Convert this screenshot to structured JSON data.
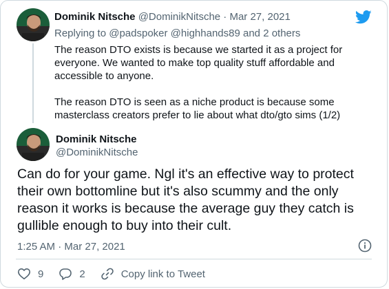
{
  "reply": {
    "author_name": "Dominik Nitsche",
    "author_handle": "@DominikNitsche",
    "separator": "·",
    "date": "Mar 27, 2021",
    "replying_prefix": "Replying to",
    "replying_to": [
      "@padspoker",
      "@highhands89"
    ],
    "replying_and": "and",
    "replying_others": "2 others",
    "paragraphs": [
      "The reason DTO exists is because we started it as a project for everyone. We wanted to make top quality stuff affordable and accessible to anyone.",
      "The reason DTO is seen as a niche product is because some masterclass creators prefer to lie about what dto/gto sims (1/2)"
    ]
  },
  "main_tweet": {
    "author_name": "Dominik Nitsche",
    "author_handle": "@DominikNitsche",
    "text": "Can do for your game. Ngl it's an effective way to protect their own bottomline but it's also scummy and the only reason it works is because the average guy they catch is gullible  enough to buy into their cult.",
    "time": "1:25 AM",
    "separator": "·",
    "date": "Mar 27, 2021"
  },
  "actions": {
    "likes": "9",
    "replies": "2",
    "copy_link_label": "Copy link to Tweet"
  },
  "icons": {
    "brand": "twitter-bird-icon",
    "info": "info-icon",
    "like": "heart-icon",
    "reply": "comment-icon",
    "copy_link": "link-icon"
  },
  "colors": {
    "twitter_blue": "#1d9bf0",
    "text_primary": "#0f1419",
    "text_secondary": "#536471",
    "border": "#cfd9de"
  }
}
